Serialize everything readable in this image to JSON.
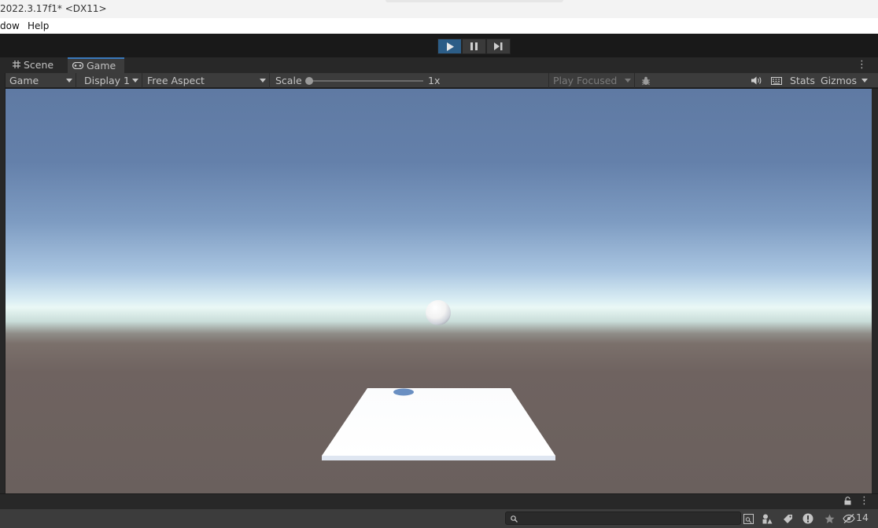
{
  "window": {
    "title": "2022.3.17f1* <DX11>"
  },
  "menu": {
    "items": [
      "dow",
      "Help"
    ]
  },
  "playbar": {
    "play_icon": "play-icon",
    "pause_icon": "pause-icon",
    "step_icon": "step-icon",
    "play_active_color": "#2c5d87"
  },
  "tabs": [
    {
      "label": "Scene",
      "icon": "scene-grid-icon",
      "active": false
    },
    {
      "label": "Game",
      "icon": "gamepad-icon",
      "active": true
    }
  ],
  "gamebar": {
    "view_select": "Game",
    "display_select": "Display 1",
    "aspect_select": "Free Aspect",
    "scale_label": "Scale",
    "scale_value": "1x",
    "scale_slider_level": 0,
    "play_mode_select": "Play Focused",
    "stats_label": "Stats",
    "gizmos_label": "Gizmos"
  },
  "scene": {
    "sky_top_color": "#5f7aa3",
    "horizon_color": "#eaf8f6",
    "ground_color": "#6a605d",
    "sphere_color": "#ffffff",
    "platform_color": "#ffffff",
    "shadow_color": "#6a8fc2"
  },
  "bottom": {
    "search_placeholder": "",
    "hidden_count": "14"
  }
}
